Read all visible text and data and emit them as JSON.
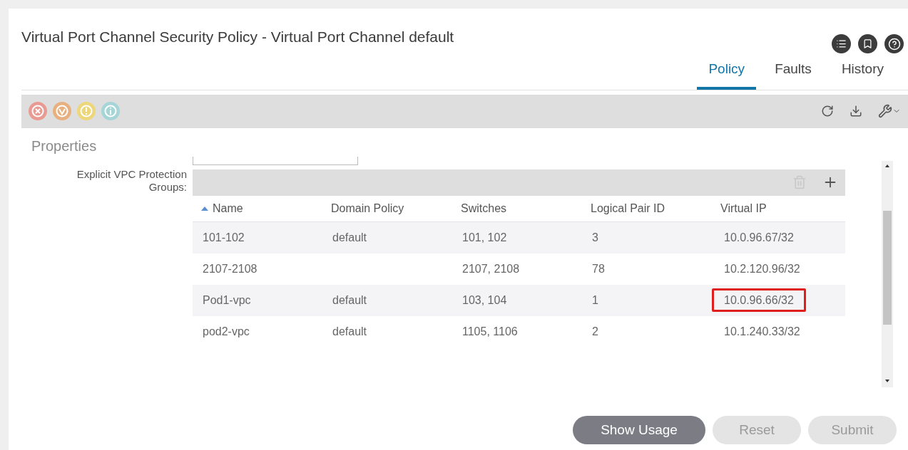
{
  "window": {
    "title": "Virtual Port Channel Security Policy - Virtual Port Channel default"
  },
  "tabs": [
    {
      "label": "Policy",
      "selected": true
    },
    {
      "label": "Faults",
      "selected": false
    },
    {
      "label": "History",
      "selected": false
    }
  ],
  "fault_indicators": [
    {
      "kind": "critical"
    },
    {
      "kind": "major"
    },
    {
      "kind": "minor"
    },
    {
      "kind": "warning"
    }
  ],
  "section_title": "Properties",
  "groups_label": "Explicit VPC Protection Groups:",
  "table": {
    "columns": [
      {
        "label": "Name",
        "sorted": true
      },
      {
        "label": "Domain Policy",
        "sorted": false
      },
      {
        "label": "Switches",
        "sorted": false
      },
      {
        "label": "Logical Pair ID",
        "sorted": false
      },
      {
        "label": "Virtual IP",
        "sorted": false
      }
    ],
    "rows": [
      {
        "name": "101-102",
        "domain_policy": "default",
        "switches": "101, 102",
        "logical_pair_id": "3",
        "virtual_ip": "10.0.96.67/32",
        "outlined": false
      },
      {
        "name": "2107-2108",
        "switches": "2107, 2108",
        "logical_pair_id": "78",
        "virtual_ip": "10.2.120.96/32",
        "outlined": false
      },
      {
        "name": "Pod1-vpc",
        "domain_policy": "default",
        "switches": "103, 104",
        "logical_pair_id": "1",
        "virtual_ip": "10.0.96.66/32",
        "outlined": true
      },
      {
        "name": "pod2-vpc",
        "domain_policy": "default",
        "switches": "1105, 1106",
        "logical_pair_id": "2",
        "virtual_ip": "10.1.240.33/32",
        "outlined": false
      }
    ]
  },
  "buttons": [
    {
      "label": "Show Usage",
      "disabled": false
    },
    {
      "label": "Reset",
      "disabled": true
    },
    {
      "label": "Submit",
      "disabled": true
    }
  ]
}
